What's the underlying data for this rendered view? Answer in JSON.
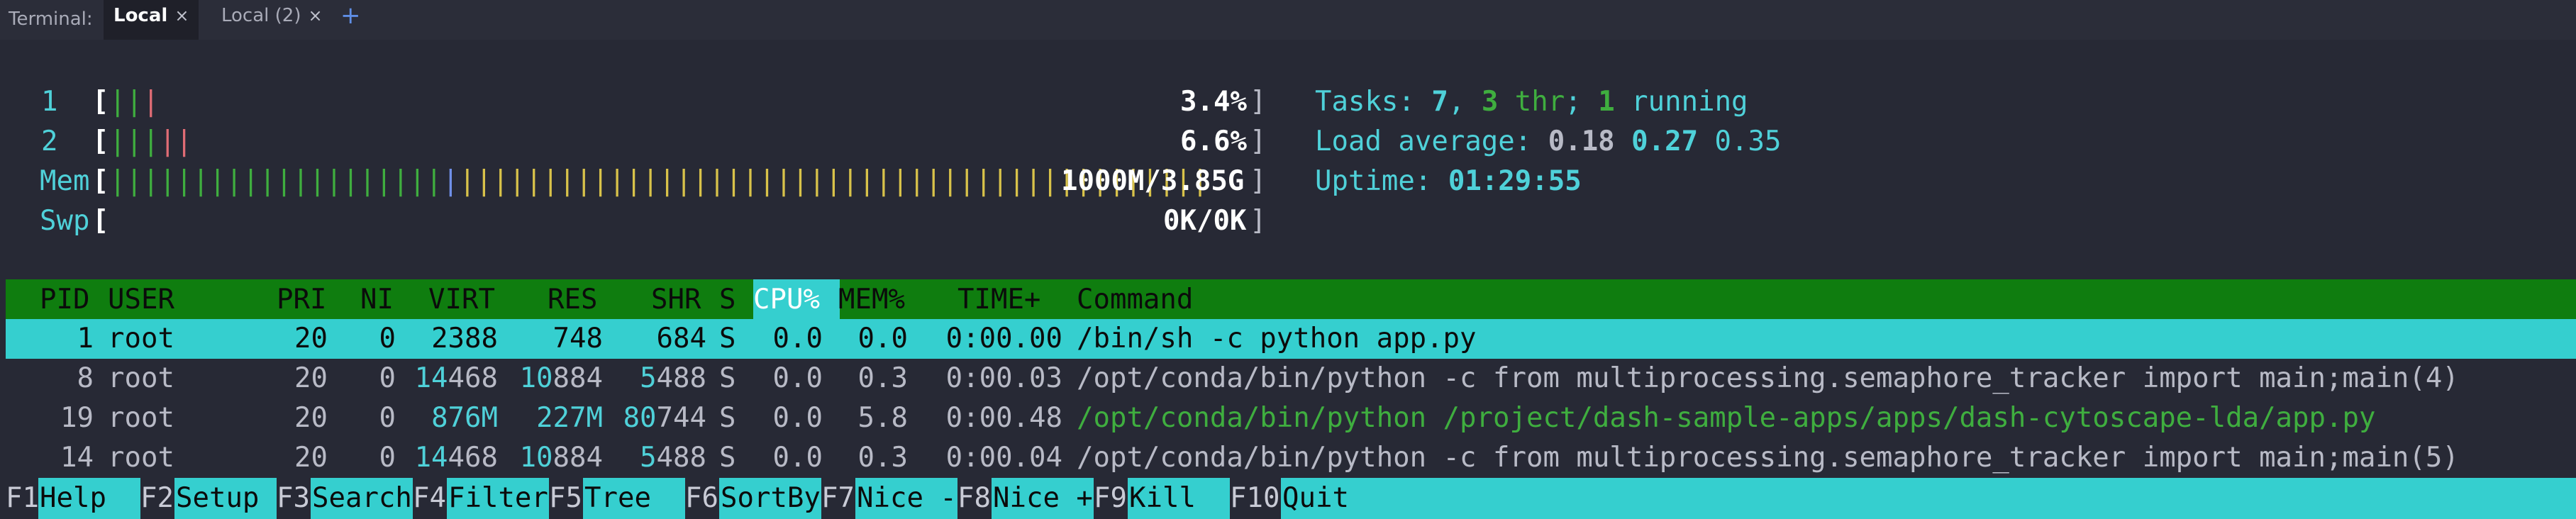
{
  "tabbar": {
    "label": "Terminal:",
    "tabs": [
      {
        "label": "Local",
        "close": "×"
      },
      {
        "label": "Local (2)",
        "close": "×"
      }
    ],
    "add": "+"
  },
  "meters": {
    "cpu1": {
      "label": "1",
      "value": "3.4%",
      "bars_green": "||",
      "bars_red": "|",
      "percent": 3.4
    },
    "cpu2": {
      "label": "2",
      "value": "6.6%",
      "bars_green": "|||",
      "bars_red": "||",
      "percent": 6.6
    },
    "mem": {
      "label": "Mem",
      "value": "1000M/3.85G",
      "bars_green": "||||||||||||||||||||",
      "bars_blue": "|",
      "bars_yellow": "|||||||||||||||||||||||||||||||||||||||||||||"
    },
    "swp": {
      "label": "Swp",
      "value": "0K/0K"
    }
  },
  "summary": {
    "tasks_label": "Tasks: ",
    "tasks": "7",
    "sep1": ", ",
    "threads": "3",
    "thr_label": " thr",
    "sep2": "; ",
    "running": "1",
    "running_label": " running",
    "load_label": "Load average: ",
    "load1": "0.18",
    "load5": "0.27",
    "load15": "0.35",
    "uptime_label": "Uptime: ",
    "uptime": "01:29:55"
  },
  "columns": [
    "PID",
    "USER",
    "PRI",
    "NI",
    "VIRT",
    "RES",
    "SHR",
    "S",
    "CPU%",
    "MEM%",
    "TIME+",
    "Command"
  ],
  "processes": [
    {
      "pid": "1",
      "user": "root",
      "pri": "20",
      "ni": "0",
      "virt": "2388",
      "res": "748",
      "shr": "684",
      "s": "S",
      "cpu": "0.0",
      "mem": "0.0",
      "time": "0:00.00",
      "command": "/bin/sh -c python app.py"
    },
    {
      "pid": "8",
      "user": "root",
      "pri": "20",
      "ni": "0",
      "virt_hi": "14",
      "virt_lo": "468",
      "res_hi": "10",
      "res_lo": "884",
      "shr_hi": "5",
      "shr_lo": "488",
      "s": "S",
      "cpu": "0.0",
      "mem": "0.3",
      "time": "0:00.03",
      "command": "/opt/conda/bin/python -c from multiprocessing.semaphore_tracker import main;main(4)"
    },
    {
      "pid": "19",
      "user": "root",
      "pri": "20",
      "ni": "0",
      "virt_hi": "876M",
      "res_hi": "227M",
      "shr_hi": "80",
      "shr_lo": "744",
      "s": "S",
      "cpu": "0.0",
      "mem": "5.8",
      "time": "0:00.48",
      "command": "/opt/conda/bin/python /project/dash-sample-apps/apps/dash-cytoscape-lda/app.py"
    },
    {
      "pid": "14",
      "user": "root",
      "pri": "20",
      "ni": "0",
      "virt_hi": "14",
      "virt_lo": "468",
      "res_hi": "10",
      "res_lo": "884",
      "shr_hi": "5",
      "shr_lo": "488",
      "s": "S",
      "cpu": "0.0",
      "mem": "0.3",
      "time": "0:00.04",
      "command": "/opt/conda/bin/python -c from multiprocessing.semaphore_tracker import main;main(5)"
    }
  ],
  "footer": [
    {
      "key": "F1",
      "label": "Help"
    },
    {
      "key": "F2",
      "label": "Setup"
    },
    {
      "key": "F3",
      "label": "Search"
    },
    {
      "key": "F4",
      "label": "Filter"
    },
    {
      "key": "F5",
      "label": "Tree"
    },
    {
      "key": "F6",
      "label": "SortBy"
    },
    {
      "key": "F7",
      "label": "Nice -"
    },
    {
      "key": "F8",
      "label": "Nice +"
    },
    {
      "key": "F9",
      "label": "Kill"
    },
    {
      "key": "F10",
      "label": "Quit"
    }
  ],
  "colors": {
    "header_bg": "#0f7d0f",
    "selection_bg": "#35cfcf",
    "background": "#272935"
  }
}
